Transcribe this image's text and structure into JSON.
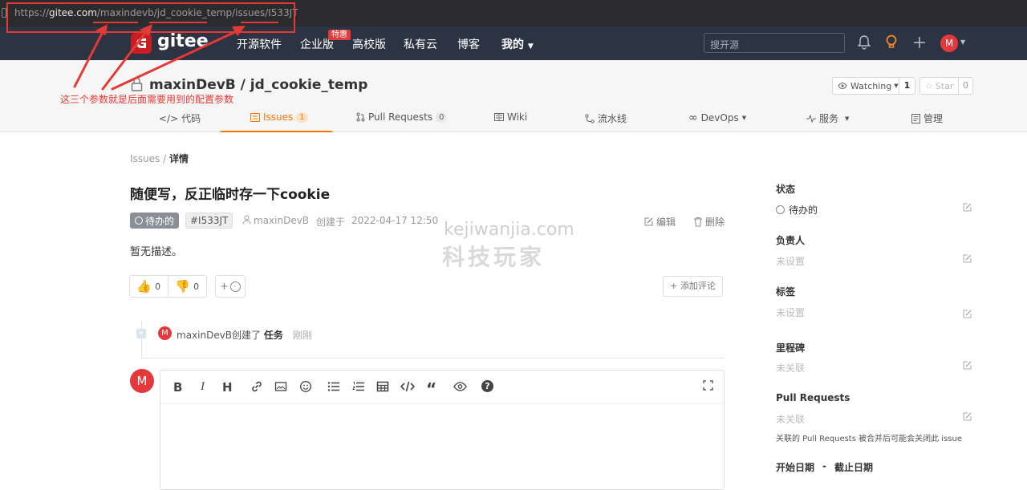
{
  "browser": {
    "url_prefix": "https://",
    "url_domain": "gitee.com",
    "url_path": "/maxindevb/jd_cookie_temp/issues/I533JT"
  },
  "annotation": {
    "text": "这三个参数就是后面需要用到的配置参数",
    "color": "#e53935"
  },
  "header": {
    "logo": "gitee",
    "nav": [
      "开源软件",
      "企业版",
      "高校版",
      "私有云",
      "博客",
      "我的"
    ],
    "enterprise_badge": "特惠",
    "search_placeholder": "搜开源",
    "avatar_letter": "M",
    "bg_color": "#2c3444"
  },
  "repo": {
    "title": "maxinDevB / jd_cookie_temp",
    "watching_label": "Watching",
    "watching_count": "1",
    "star_label": "Star",
    "star_count": "0",
    "tabs": [
      {
        "label": "代码"
      },
      {
        "label": "Issues",
        "count": "1"
      },
      {
        "label": "Pull Requests",
        "count": "0"
      },
      {
        "label": "Wiki"
      },
      {
        "label": "流水线"
      },
      {
        "label": "DevOps"
      },
      {
        "label": "服务"
      },
      {
        "label": "管理"
      }
    ],
    "active_color": "#fe7300"
  },
  "breadcrumb": {
    "root": "Issues",
    "sep": "/",
    "current": "详情"
  },
  "issue": {
    "title": "随便写，反正临时存一下cookie",
    "status": "待办的",
    "id": "#I533JT",
    "author": "maxinDevB",
    "created_label": "创建于",
    "created_at": "2022-04-17 12:50",
    "edit_label": "编辑",
    "delete_label": "删除",
    "body": "暂无描述。",
    "thumbs_up": "0",
    "thumbs_down": "0",
    "add_reaction": "+",
    "add_comment": "+ 添加评论"
  },
  "timeline": {
    "avatar_letter": "M",
    "user": "maxinDevB",
    "action": "创建了",
    "object": "任务",
    "time": "刚刚"
  },
  "editor": {
    "avatar_letter": "M",
    "toolbar": [
      "bold-icon",
      "italic-icon",
      "heading-icon",
      "link-icon",
      "image-icon",
      "emoji-icon",
      "bullet-list-icon",
      "numbered-list-icon",
      "table-icon",
      "code-icon",
      "quote-icon",
      "preview-icon",
      "help-icon",
      "fullscreen-icon"
    ]
  },
  "sidebar": {
    "status_label": "状态",
    "status_value": "待办的",
    "assignee_label": "负责人",
    "assignee_value": "未设置",
    "label_label": "标签",
    "label_value": "未设置",
    "milestone_label": "里程碑",
    "milestone_value": "未关联",
    "pr_label": "Pull Requests",
    "pr_value": "未关联",
    "pr_note": "关联的 Pull Requests 被合并后可能会关闭此 issue",
    "start_label": "开始日期",
    "date_sep": "-",
    "end_label": "截止日期"
  },
  "watermark": {
    "line1": "kejiwanjia.com",
    "line2": "科技玩家"
  }
}
